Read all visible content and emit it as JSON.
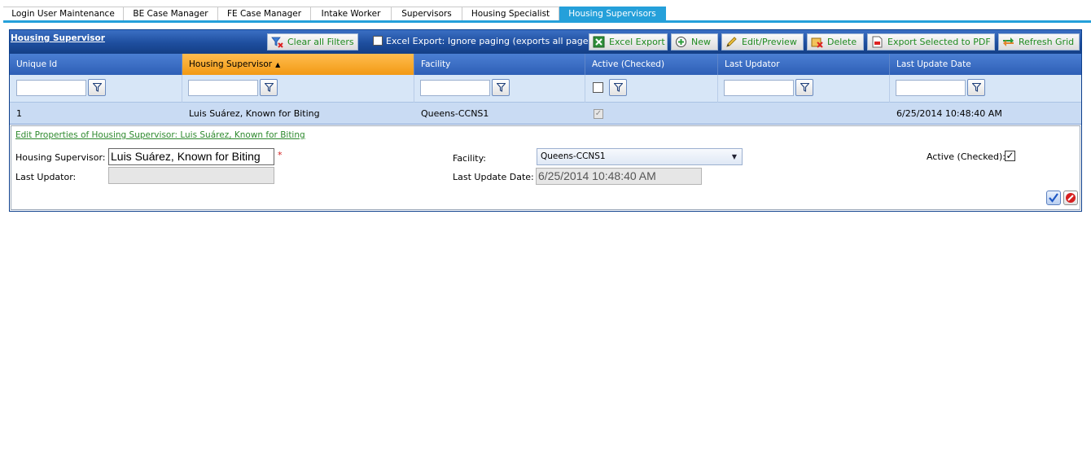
{
  "tabs": [
    {
      "label": "Login User Maintenance",
      "active": false
    },
    {
      "label": "BE Case Manager",
      "active": false
    },
    {
      "label": "FE Case Manager",
      "active": false
    },
    {
      "label": "Intake Worker",
      "active": false
    },
    {
      "label": "Supervisors",
      "active": false
    },
    {
      "label": "Housing Specialist",
      "active": false
    },
    {
      "label": "Housing Supervisors",
      "active": true
    }
  ],
  "grid": {
    "title": "Housing Supervisor",
    "toolbar": {
      "clear_filters": "Clear all Filters",
      "excel_ignore_paging": "Excel Export: Ignore paging (exports all pages)",
      "excel_export": "Excel Export",
      "new": "New",
      "edit_preview": "Edit/Preview",
      "delete": "Delete",
      "export_pdf": "Export Selected to PDF",
      "refresh": "Refresh Grid"
    },
    "columns": [
      "Unique Id",
      "Housing Supervisor",
      "Facility",
      "Active (Checked)",
      "Last Updator",
      "Last Update Date"
    ],
    "sorted_column": "Housing Supervisor",
    "sort_direction": "ascending",
    "rows": [
      {
        "unique_id": "1",
        "housing_supervisor": "Luis Suárez, Known for Biting",
        "facility": "Queens-CCNS1",
        "active": true,
        "last_updator": "",
        "last_update_date": "6/25/2014 10:48:40 AM"
      }
    ]
  },
  "edit_form": {
    "heading": "Edit Properties of Housing  Supervisor: Luis Suárez, Known for Biting",
    "housing_supervisor_label": "Housing Supervisor:",
    "housing_supervisor_value": "Luis Suárez, Known for Biting",
    "required_marker": "*",
    "last_updator_label": "Last Updator:",
    "last_updator_value": "",
    "facility_label": "Facility:",
    "facility_value": "Queens-CCNS1",
    "last_update_date_label": "Last Update Date:",
    "last_update_date_value": "6/25/2014 10:48:40 AM",
    "active_label": "Active (Checked):",
    "active_checked": true
  },
  "colors": {
    "tab_active": "#25a0da",
    "header_blue": "#2e5fb6",
    "sorted_header": "#f29a14",
    "button_text_green": "#1f8a1f",
    "row_selected": "#c9dbf3"
  }
}
